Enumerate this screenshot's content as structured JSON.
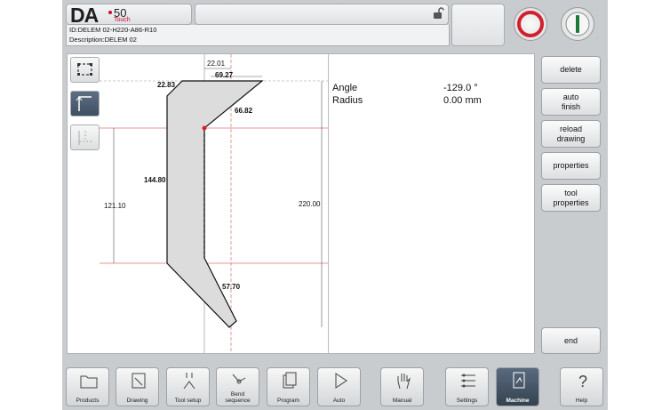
{
  "logo": {
    "brand": "DA",
    "model": "50",
    "suffix": "Touch"
  },
  "product": {
    "id_line": "ID:DELEM 02-H220-A86-R10",
    "description_line": "Description:DELEM 02"
  },
  "properties": [
    {
      "label": "Angle",
      "value": "-129.0 °"
    },
    {
      "label": "Radius",
      "value": "0.00 mm"
    }
  ],
  "drawing": {
    "dimensions": {
      "top_offset": "22.01",
      "top_width": "69.27",
      "top_left": "22.83",
      "slope": "66.82",
      "left_height": "144.80",
      "lower_height": "121.10",
      "total_height": "220.00",
      "tip_length": "57.70"
    }
  },
  "right_buttons": [
    {
      "id": "delete",
      "label": "delete"
    },
    {
      "id": "auto-finish",
      "label": "auto\nfinish"
    },
    {
      "id": "reload-drawing",
      "label": "reload\ndrawing"
    },
    {
      "id": "properties",
      "label": "properties"
    },
    {
      "id": "tool-properties",
      "label": "tool\nproperties"
    },
    {
      "id": "end",
      "label": "end"
    }
  ],
  "nav": [
    {
      "id": "products",
      "label": "Products",
      "icon": "folder-icon"
    },
    {
      "id": "drawing",
      "label": "Drawing",
      "icon": "pencil-icon"
    },
    {
      "id": "tool-setup",
      "label": "Tool setup",
      "icon": "tool-icon"
    },
    {
      "id": "bend-sequence",
      "label": "Bend\nsequence",
      "icon": "bend-icon"
    },
    {
      "id": "program",
      "label": "Program",
      "icon": "pages-icon"
    },
    {
      "id": "auto",
      "label": "Auto",
      "icon": "play-icon"
    },
    {
      "id": "manual",
      "label": "Manual",
      "icon": "hand-icon"
    },
    {
      "id": "settings",
      "label": "Settings",
      "icon": "list-icon"
    },
    {
      "id": "machine",
      "label": "Machine",
      "icon": "machine-icon",
      "active": true
    },
    {
      "id": "help",
      "label": "Help",
      "icon": "question-icon"
    }
  ],
  "colors": {
    "stop_ring": "#d0212e",
    "start_bar": "#1a7a3a",
    "frame": "#c9cccf",
    "active_nav": "#3f4f63"
  }
}
